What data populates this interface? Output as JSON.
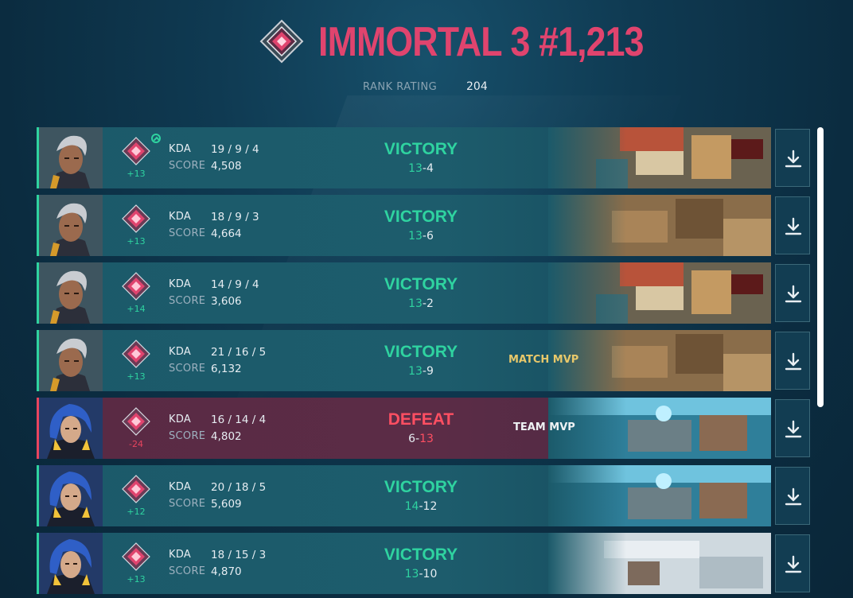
{
  "header": {
    "rank_title": "IMMORTAL 3 #1,213",
    "rank_rating_label": "RANK RATING",
    "rank_rating_value": "204"
  },
  "colors": {
    "win_accent": "#2fd3a0",
    "loss_accent": "#e8445e",
    "rank_title": "#e0446e",
    "match_mvp": "#e8c86a"
  },
  "labels": {
    "kda": "KDA",
    "score": "SCORE"
  },
  "matches": [
    {
      "agent": "gray-haired-agent",
      "rr_delta": "+13",
      "rank_up_icon": true,
      "kda": "19 / 9 / 4",
      "score": "4,508",
      "result": "VICTORY",
      "outcome": "win",
      "score_ours": "13",
      "score_dash": "-",
      "score_theirs": "4",
      "mvp": "",
      "map": "orange-roof-map",
      "download_icon": "download-icon"
    },
    {
      "agent": "gray-haired-agent",
      "rr_delta": "+13",
      "rank_up_icon": false,
      "kda": "18 / 9 / 3",
      "score": "4,664",
      "result": "VICTORY",
      "outcome": "win",
      "score_ours": "13",
      "score_dash": "-",
      "score_theirs": "6",
      "mvp": "",
      "map": "desert-map",
      "download_icon": "download-icon"
    },
    {
      "agent": "gray-haired-agent",
      "rr_delta": "+14",
      "rank_up_icon": false,
      "kda": "14 / 9 / 4",
      "score": "3,606",
      "result": "VICTORY",
      "outcome": "win",
      "score_ours": "13",
      "score_dash": "-",
      "score_theirs": "2",
      "mvp": "",
      "map": "orange-roof-map",
      "download_icon": "download-icon"
    },
    {
      "agent": "gray-haired-agent",
      "rr_delta": "+13",
      "rank_up_icon": false,
      "kda": "21 / 16 / 5",
      "score": "6,132",
      "result": "VICTORY",
      "outcome": "win",
      "score_ours": "13",
      "score_dash": "-",
      "score_theirs": "9",
      "mvp": "MATCH MVP",
      "map": "desert-map",
      "download_icon": "download-icon"
    },
    {
      "agent": "blue-haired-agent",
      "rr_delta": "-24",
      "rank_up_icon": false,
      "kda": "16 / 14 / 4",
      "score": "4,802",
      "result": "DEFEAT",
      "outcome": "loss",
      "score_ours": "6",
      "score_dash": "-",
      "score_theirs": "13",
      "mvp": "TEAM MVP",
      "map": "coastal-map",
      "download_icon": "download-icon"
    },
    {
      "agent": "blue-haired-agent",
      "rr_delta": "+12",
      "rank_up_icon": false,
      "kda": "20 / 18 / 5",
      "score": "5,609",
      "result": "VICTORY",
      "outcome": "win",
      "score_ours": "14",
      "score_dash": "-",
      "score_theirs": "12",
      "mvp": "",
      "map": "coastal-map",
      "download_icon": "download-icon"
    },
    {
      "agent": "blue-haired-agent",
      "rr_delta": "+13",
      "rank_up_icon": false,
      "kda": "18 / 15 / 3",
      "score": "4,870",
      "result": "VICTORY",
      "outcome": "win",
      "score_ours": "13",
      "score_dash": "-",
      "score_theirs": "10",
      "mvp": "",
      "map": "snowy-map",
      "download_icon": "download-icon"
    }
  ]
}
